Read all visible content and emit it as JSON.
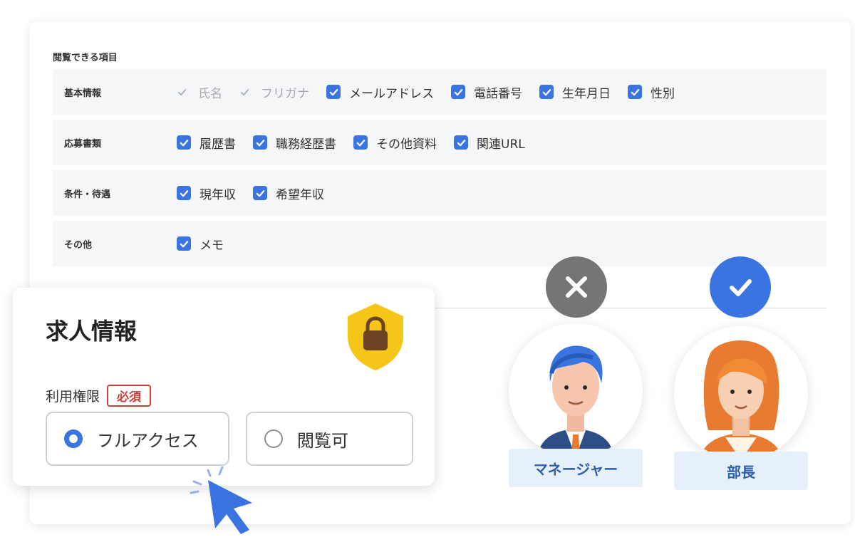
{
  "permissions": {
    "section_title": "閲覧できる項目",
    "rows": [
      {
        "category": "基本情報",
        "items": [
          {
            "label": "氏名",
            "checked": true,
            "disabled": true
          },
          {
            "label": "フリガナ",
            "checked": true,
            "disabled": true
          },
          {
            "label": "メールアドレス",
            "checked": true,
            "disabled": false
          },
          {
            "label": "電話番号",
            "checked": true,
            "disabled": false
          },
          {
            "label": "生年月日",
            "checked": true,
            "disabled": false
          },
          {
            "label": "性別",
            "checked": true,
            "disabled": false
          }
        ]
      },
      {
        "category": "応募書類",
        "items": [
          {
            "label": "履歴書",
            "checked": true,
            "disabled": false
          },
          {
            "label": "職務経歴書",
            "checked": true,
            "disabled": false
          },
          {
            "label": "その他資料",
            "checked": true,
            "disabled": false
          },
          {
            "label": "関連URL",
            "checked": true,
            "disabled": false
          }
        ]
      },
      {
        "category": "条件・待遇",
        "items": [
          {
            "label": "現年収",
            "checked": true,
            "disabled": false
          },
          {
            "label": "希望年収",
            "checked": true,
            "disabled": false
          }
        ]
      },
      {
        "category": "その他",
        "items": [
          {
            "label": "メモ",
            "checked": true,
            "disabled": false
          }
        ]
      }
    ]
  },
  "job_card": {
    "title": "求人情報",
    "permission_label": "利用権限",
    "required_badge": "必須",
    "options": [
      {
        "label": "フルアクセス",
        "selected": true
      },
      {
        "label": "閲覧可",
        "selected": false
      }
    ]
  },
  "roles": [
    {
      "label": "マネージャー",
      "access": "denied",
      "icon": "close-icon",
      "status_color": "#757575"
    },
    {
      "label": "部長",
      "access": "allowed",
      "icon": "check-icon",
      "status_color": "#3a74e0"
    }
  ],
  "colors": {
    "accent": "#3a74e0",
    "required": "#c8423a",
    "shield": "#f5c518",
    "role_label_bg": "#e6f0fb"
  }
}
